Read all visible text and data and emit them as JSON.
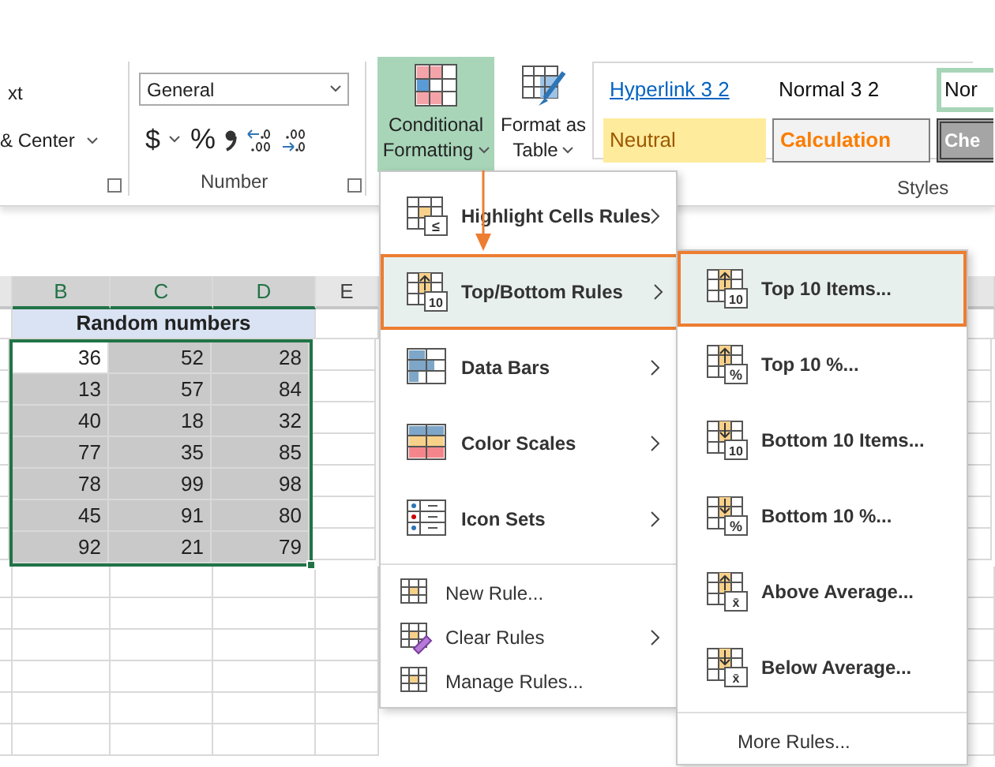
{
  "ribbon": {
    "alignment_group": {
      "wrap_text": "xt",
      "merge": "& Center"
    },
    "number_group": {
      "format": "General",
      "currency": "$",
      "percent": "%",
      "label": "Number"
    },
    "conditional_formatting": {
      "label_1": "Conditional",
      "label_2": "Formatting",
      "selected": true
    },
    "format_as_table": {
      "label_1": "Format as",
      "label_2": "Table"
    },
    "styles": {
      "label": "Styles",
      "items": [
        {
          "label": "Hyperlink 3 2",
          "kind": "hyperlink"
        },
        {
          "label": "Normal 3 2",
          "kind": "normal"
        },
        {
          "label": "Nor",
          "kind": "good"
        },
        {
          "label": "Neutral",
          "kind": "neutral"
        },
        {
          "label": "Calculation",
          "kind": "calculation"
        },
        {
          "label": "Che",
          "kind": "check"
        }
      ]
    }
  },
  "sheet": {
    "columns": [
      {
        "label": "B",
        "selected": true
      },
      {
        "label": "C",
        "selected": true
      },
      {
        "label": "D",
        "selected": true
      },
      {
        "label": "E",
        "selected": false
      }
    ],
    "title": "Random numbers",
    "rows": [
      [
        {
          "value": "36",
          "active": true
        },
        {
          "value": "52",
          "active": false
        },
        {
          "value": "28",
          "active": false
        }
      ],
      [
        {
          "value": "13",
          "active": false
        },
        {
          "value": "57",
          "active": false
        },
        {
          "value": "84",
          "active": false
        }
      ],
      [
        {
          "value": "40",
          "active": false
        },
        {
          "value": "18",
          "active": false
        },
        {
          "value": "32",
          "active": false
        }
      ],
      [
        {
          "value": "77",
          "active": false
        },
        {
          "value": "35",
          "active": false
        },
        {
          "value": "85",
          "active": false
        }
      ],
      [
        {
          "value": "78",
          "active": false
        },
        {
          "value": "99",
          "active": false
        },
        {
          "value": "98",
          "active": false
        }
      ],
      [
        {
          "value": "45",
          "active": false
        },
        {
          "value": "91",
          "active": false
        },
        {
          "value": "80",
          "active": false
        }
      ],
      [
        {
          "value": "92",
          "active": false
        },
        {
          "value": "21",
          "active": false
        },
        {
          "value": "79",
          "active": false
        }
      ]
    ]
  },
  "menu": {
    "items": [
      {
        "label": "Highlight Cells Rules",
        "kind": "highlight",
        "badge": "≤",
        "submenu": true,
        "selected": false
      },
      {
        "label": "Top/Bottom Rules",
        "kind": "topbottom",
        "badge": "10",
        "submenu": true,
        "selected": true
      },
      {
        "label": "Data Bars",
        "kind": "databars",
        "submenu": true,
        "selected": false
      },
      {
        "label": "Color Scales",
        "kind": "colorscales",
        "submenu": true,
        "selected": false
      },
      {
        "label": "Icon Sets",
        "kind": "iconsets",
        "submenu": true,
        "selected": false
      }
    ],
    "commands": [
      {
        "label": "New Rule...",
        "kind": "new",
        "submenu": false
      },
      {
        "label": "Clear Rules",
        "kind": "clear",
        "submenu": true
      },
      {
        "label": "Manage Rules...",
        "kind": "manage",
        "submenu": false
      }
    ]
  },
  "submenu": {
    "items": [
      {
        "label": "Top 10 Items...",
        "kind": "up",
        "badge": "10",
        "selected": true
      },
      {
        "label": "Top 10 %...",
        "kind": "up",
        "badge": "%",
        "selected": false
      },
      {
        "label": "Bottom 10 Items...",
        "kind": "down",
        "badge": "10",
        "selected": false
      },
      {
        "label": "Bottom 10 %...",
        "kind": "down",
        "badge": "%",
        "selected": false
      },
      {
        "label": "Above Average...",
        "kind": "up",
        "badge": "x̄",
        "selected": false
      },
      {
        "label": "Below Average...",
        "kind": "down",
        "badge": "x̄",
        "selected": false
      }
    ],
    "more": "More Rules..."
  }
}
